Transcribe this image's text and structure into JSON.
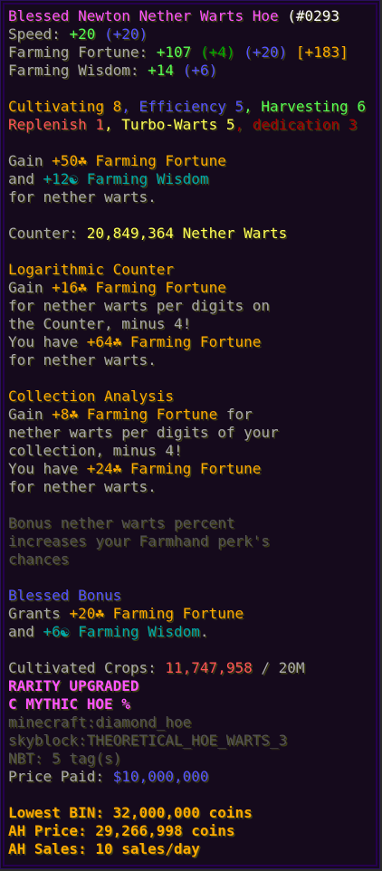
{
  "title": {
    "name": "Blessed Newton Nether Warts Hoe",
    "id": "(#0293"
  },
  "stats": {
    "speed_label": "Speed: ",
    "speed_value": "+20",
    "speed_bonus": "(+20)",
    "ff_label": "Farming Fortune: ",
    "ff_value": "+107",
    "ff_b1": "(+4)",
    "ff_b2": "(+20)",
    "ff_b3": "[+183]",
    "fw_label": "Farming Wisdom: ",
    "fw_value": "+14",
    "fw_bonus": "(+6)"
  },
  "enchants": {
    "e1": "Cultivating 8",
    "e2": "Efficiency 5",
    "e3": "Harvesting 6",
    "e4": "Replenish 1",
    "e5": "Turbo-Warts 5",
    "e6": "dedication 3",
    "sep": ", "
  },
  "ability": {
    "l1_pre": "Gain ",
    "l1_val": "+50☘ Farming Fortune",
    "l2_pre": "and ",
    "l2_val": "+12☯ Farming Wisdom",
    "l3": "for nether warts."
  },
  "counter": {
    "label": "Counter: ",
    "value": "20,849,364 Nether Warts"
  },
  "log_counter": {
    "title": "Logarithmic Counter",
    "l1_pre": "Gain ",
    "l1_val": "+16☘ Farming Fortune",
    "l2": "for nether warts per digits on",
    "l3": "the Counter, minus 4!",
    "l4_pre": "You have ",
    "l4_val": "+64☘ Farming Fortune",
    "l5": "for nether warts."
  },
  "collection": {
    "title": "Collection Analysis",
    "l1_pre": "Gain ",
    "l1_val": "+8☘ Farming Fortune",
    "l1_post": " for",
    "l2": "nether warts per digits of your",
    "l3": "collection, minus 4!",
    "l4_pre": "You have ",
    "l4_val": "+24☘ Farming Fortune",
    "l5": "for nether warts."
  },
  "perk": {
    "l1": "Bonus nether warts percent",
    "l2": "increases your Farmhand perk's",
    "l3": "chances"
  },
  "blessed": {
    "title": "Blessed Bonus",
    "l1_pre": "Grants ",
    "l1_val": "+20☘ Farming Fortune",
    "l2_pre": "and ",
    "l2_val": "+6☯ Farming Wisdom",
    "l2_post": "."
  },
  "crops": {
    "label": "Cultivated Crops: ",
    "value": "11,747,958",
    "sep": " / ",
    "max": "20M"
  },
  "rarity": {
    "upgraded": "RARITY UPGRADED",
    "line": "C MYTHIC HOE %"
  },
  "meta": {
    "item": "minecraft:diamond_hoe",
    "skyblock": "skyblock:THEORETICAL_HOE_WARTS_3",
    "nbt": "NBT: 5 tag(s)"
  },
  "price": {
    "label": "Price Paid: ",
    "value": "$10,000,000"
  },
  "market": {
    "bin_label": "Lowest BIN: ",
    "bin_value": "32,000,000 coins",
    "ah_label": "AH Price: ",
    "ah_value": "29,266,998 coins",
    "sales_label": "AH Sales: ",
    "sales_value": "10 sales/day"
  }
}
